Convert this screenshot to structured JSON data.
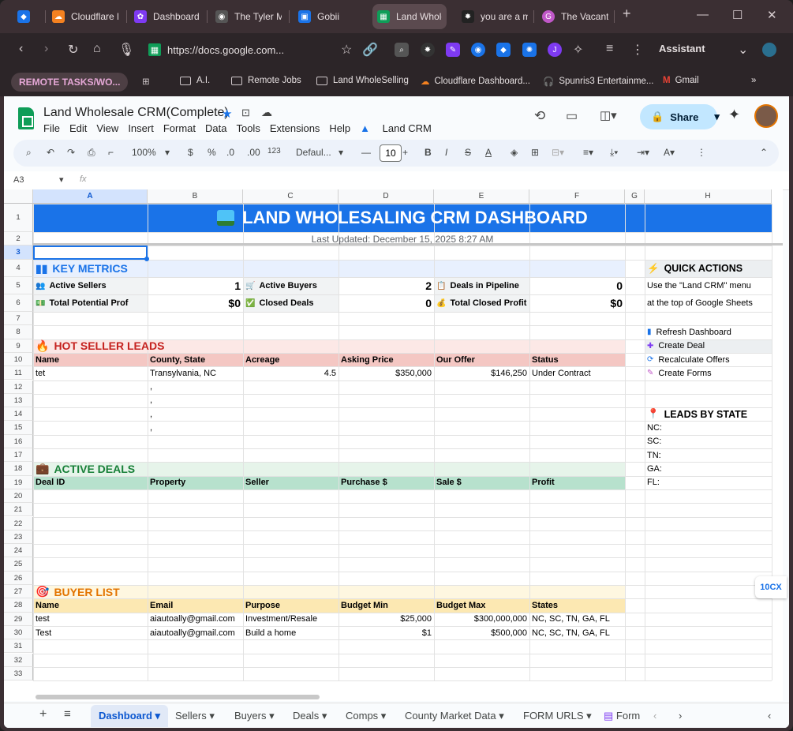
{
  "browser": {
    "tabs": [
      {
        "title": "",
        "color": "#1a73e8",
        "glyph": "◆"
      },
      {
        "title": "Cloudflare D",
        "color": "#f48120",
        "glyph": "☁"
      },
      {
        "title": "Dashboard -",
        "color": "#7e3af2",
        "glyph": "✿"
      },
      {
        "title": "The Tyler Mc",
        "color": "#555555",
        "glyph": "◉"
      },
      {
        "title": "Gobii",
        "color": "#1a73e8",
        "glyph": "▣"
      },
      {
        "title": "Land Wholes",
        "color": "#0f9d58",
        "glyph": "▦"
      },
      {
        "title": "you are a m",
        "color": "#222222",
        "glyph": "✸"
      },
      {
        "title": "The Vacant L",
        "color": "#c058c8",
        "glyph": "G"
      }
    ],
    "url": "https://docs.google.com...",
    "assistant_label": "Assistant",
    "bookmarks": {
      "remote": "REMOTE TASKS/WO...",
      "items": [
        "A.I.",
        "Remote Jobs",
        "Land WholeSelling",
        "Cloudflare Dashboard...",
        "Spunris3 Entertainme...",
        "Gmail"
      ]
    }
  },
  "sheets": {
    "doc_title": "Land Wholesale CRM(Complete)",
    "menu": [
      "File",
      "Edit",
      "View",
      "Insert",
      "Format",
      "Data",
      "Tools",
      "Extensions",
      "Help"
    ],
    "custom_menu": "Land CRM",
    "share_label": "Share",
    "zoom": "100%",
    "font_name": "Defaul...",
    "font_size": "10",
    "cell_ref": "A3",
    "fx": "fx",
    "columns": [
      "A",
      "B",
      "C",
      "D",
      "E",
      "F",
      "G",
      "H"
    ],
    "rows": [
      "1",
      "2",
      "3",
      "4",
      "5",
      "6",
      "7",
      "8",
      "9",
      "10",
      "11",
      "12",
      "13",
      "14",
      "15",
      "16",
      "17",
      "18",
      "19",
      "20",
      "21",
      "22",
      "23",
      "24",
      "25",
      "26",
      "27",
      "28",
      "29",
      "30",
      "31",
      "32",
      "33"
    ]
  },
  "dashboard": {
    "title": "LAND WHOLESALING CRM DASHBOARD",
    "updated": "Last Updated: December 15, 2025  8:27 AM",
    "key_metrics": {
      "heading": "KEY METRICS",
      "active_sellers_label": "Active Sellers",
      "active_sellers": "1",
      "active_buyers_label": "Active Buyers",
      "active_buyers": "2",
      "deals_pipeline_label": "Deals in Pipeline",
      "deals_pipeline": "0",
      "total_potential_label": "Total Potential Profit",
      "total_potential": "$0",
      "closed_deals_label": "Closed Deals",
      "closed_deals": "0",
      "total_closed_label": "Total Closed Profit",
      "total_closed": "$0"
    },
    "hot_leads": {
      "heading": "HOT SELLER LEADS",
      "headers": [
        "Name",
        "County, State",
        "Acreage",
        "Asking Price",
        "Our Offer",
        "Status"
      ],
      "row": [
        "tet",
        "Transylvania, NC",
        "4.5",
        "$350,000",
        "$146,250",
        "Under Contract"
      ],
      "commas": [
        ",",
        ",",
        ",",
        ","
      ]
    },
    "active_deals": {
      "heading": "ACTIVE DEALS",
      "headers": [
        "Deal ID",
        "Property",
        "Seller",
        "Purchase $",
        "Sale $",
        "Profit"
      ]
    },
    "buyers": {
      "heading": "BUYER LIST",
      "headers": [
        "Name",
        "Email",
        "Purpose",
        "Budget Min",
        "Budget Max",
        "States"
      ],
      "rows": [
        [
          "test",
          "aiautoally@gmail.com",
          "Investment/Resale",
          "$25,000",
          "$300,000,000",
          "NC, SC, TN, GA, FL"
        ],
        [
          "Test",
          "aiautoally@gmail.com",
          "Build a home",
          "$1",
          "$500,000",
          "NC, SC, TN, GA, FL"
        ]
      ]
    },
    "quick_actions": {
      "heading": "QUICK ACTIONS",
      "line1": "Use the \"Land CRM\" menu",
      "line2": "at the top of Google Sheets",
      "items": [
        "Refresh Dashboard",
        "Create Deal",
        "Recalculate Offers",
        "Create Forms"
      ]
    },
    "leads_by_state": {
      "heading": "LEADS BY STATE",
      "states": [
        "NC:",
        "SC:",
        "TN:",
        "GA:",
        "FL:"
      ]
    }
  },
  "sheet_tabs": [
    "Dashboard",
    "Sellers",
    "Buyers",
    "Deals",
    "Comps",
    "County Market Data",
    "FORM URLS",
    "Form"
  ],
  "badge": "10CX",
  "colors": {
    "title_band": "#1a73e8",
    "metrics_band": "#e8f0fe",
    "leads_band": "#fce8e6",
    "leads_hdr": "#f4c7c3",
    "deals_band": "#e6f4ea",
    "deals_hdr": "#b7e1cd",
    "buyers_band": "#fef7e0",
    "buyers_hdr": "#fce8b2"
  }
}
